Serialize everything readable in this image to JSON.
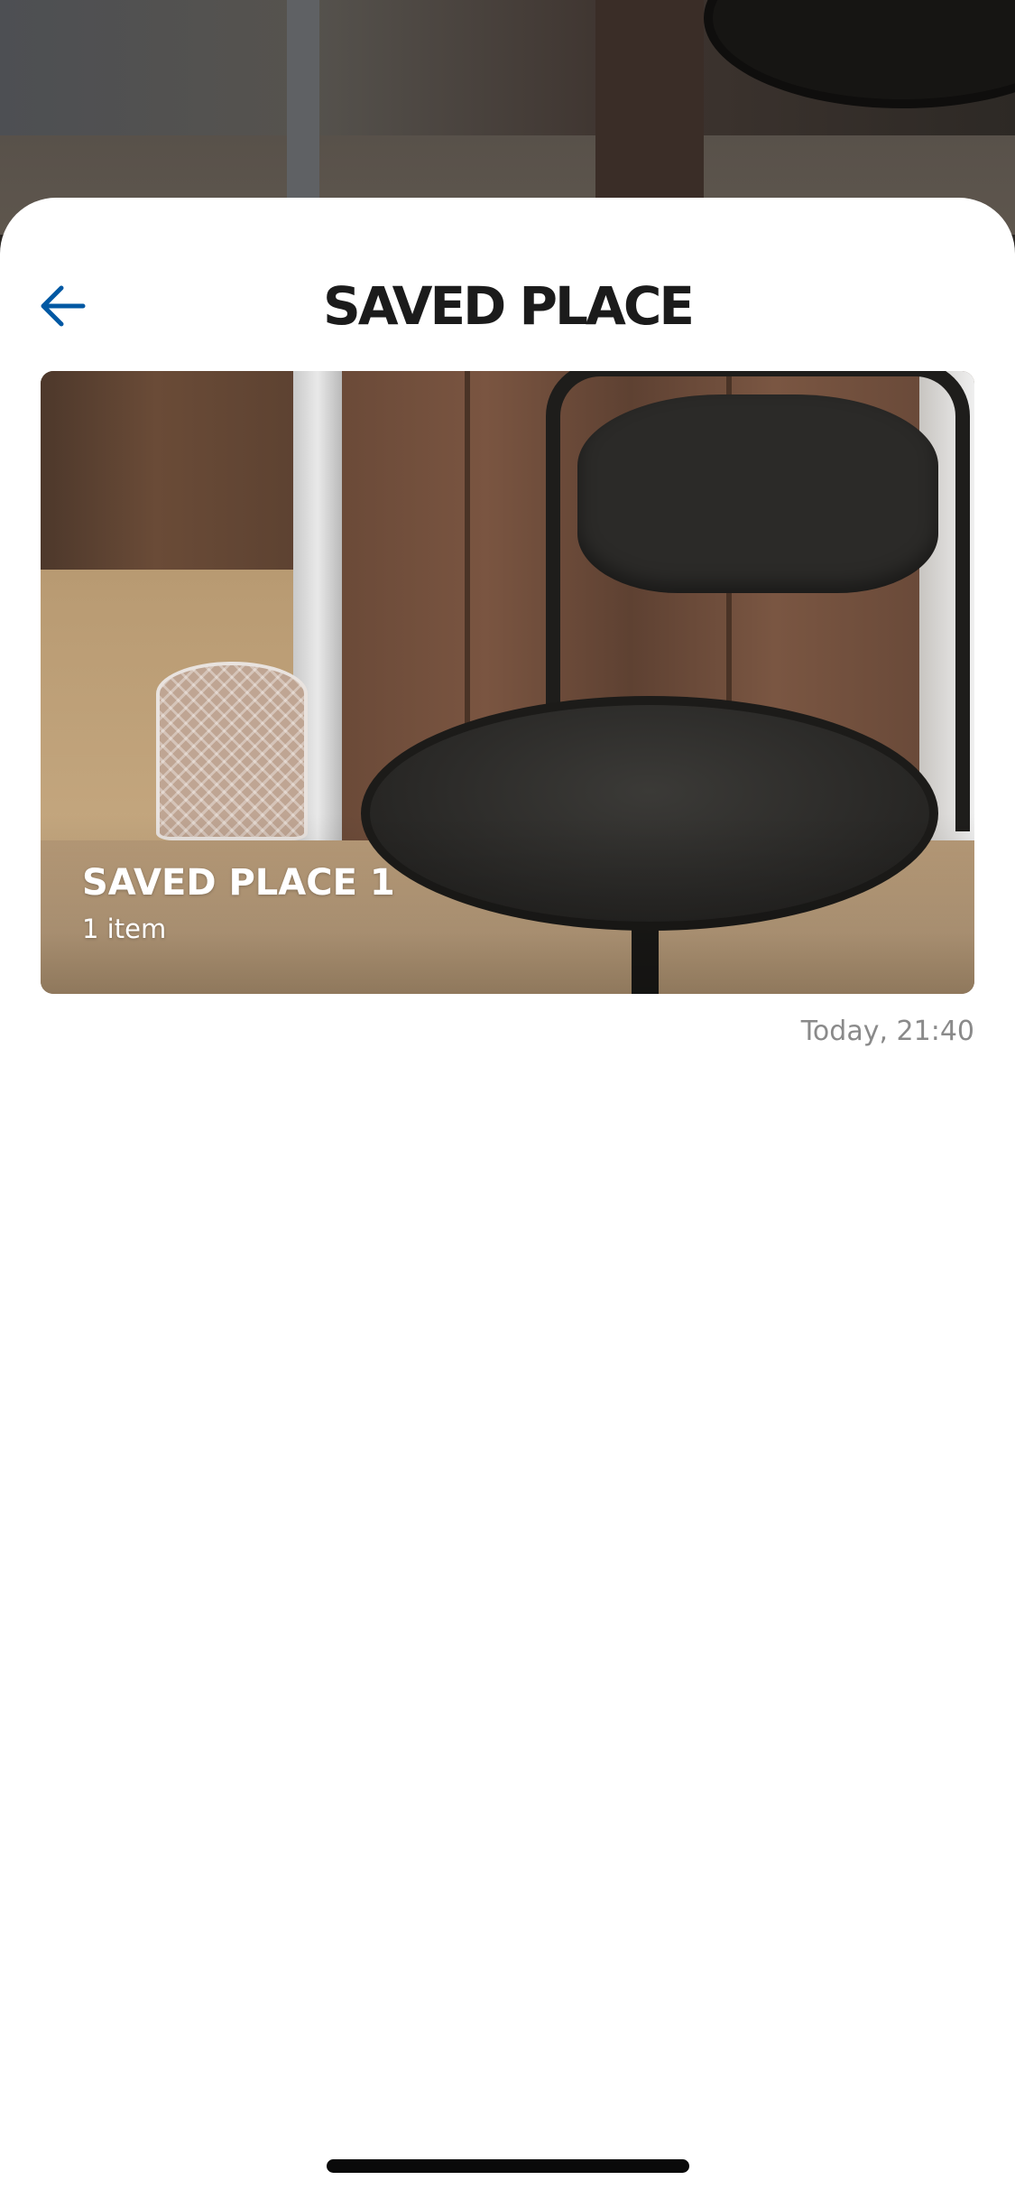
{
  "colors": {
    "accent": "#0058a3",
    "title": "#1b1b1b",
    "muted": "#8a8a8a",
    "sheet_bg": "#ffffff"
  },
  "header": {
    "back_icon": "arrow-left-icon",
    "title": "SAVED PLACE"
  },
  "saved_places": [
    {
      "name": "SAVED PLACE 1",
      "item_count": "1 item",
      "timestamp": "Today, 21:40"
    }
  ]
}
